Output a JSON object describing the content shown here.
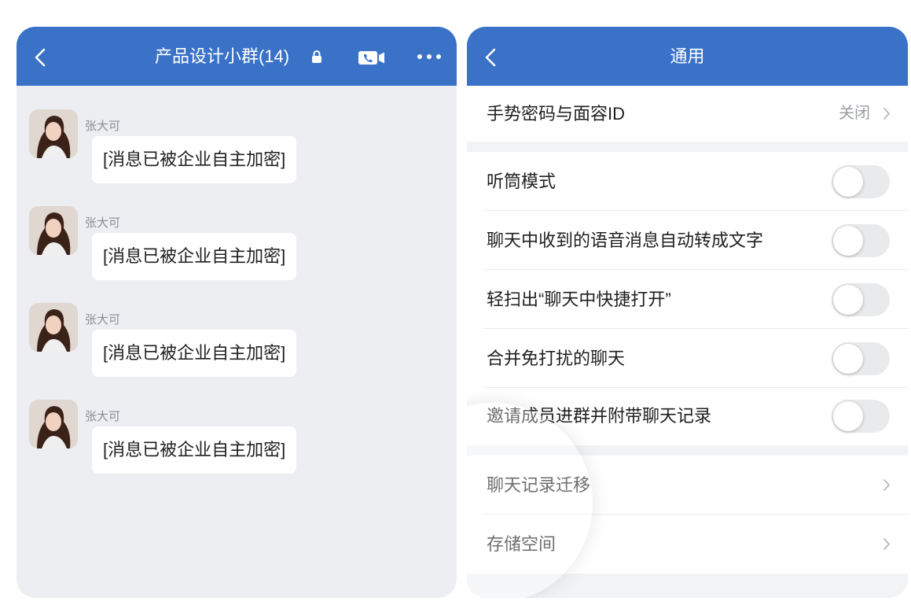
{
  "colors": {
    "accent": "#3a72c8",
    "chat_bg": "#eceef2",
    "settings_bg": "#f2f3f5",
    "toggle_off": "#e9eaec"
  },
  "chat": {
    "title": "产品设计小群(14)",
    "icons": {
      "back": "chevron-left-icon",
      "lock": "lock-icon",
      "video": "video-call-icon",
      "more": "more-icon"
    },
    "messages": [
      {
        "sender": "张大可",
        "text": "[消息已被企业自主加密]"
      },
      {
        "sender": "张大可",
        "text": "[消息已被企业自主加密]"
      },
      {
        "sender": "张大可",
        "text": "[消息已被企业自主加密]"
      },
      {
        "sender": "张大可",
        "text": "[消息已被企业自主加密]"
      }
    ]
  },
  "settings": {
    "title": "通用",
    "gesture": {
      "label": "手势密码与面容ID",
      "value": "关闭"
    },
    "toggles": [
      {
        "label": "听筒模式",
        "on": false
      },
      {
        "label": "聊天中收到的语音消息自动转成文字",
        "on": false
      },
      {
        "label": "轻扫出“聊天中快捷打开”",
        "on": false
      },
      {
        "label": "合并免打扰的聊天",
        "on": false
      },
      {
        "label": "邀请成员进群并附带聊天记录",
        "on": false
      }
    ],
    "links": [
      {
        "label": "聊天记录迁移"
      },
      {
        "label": "存储空间"
      }
    ]
  }
}
